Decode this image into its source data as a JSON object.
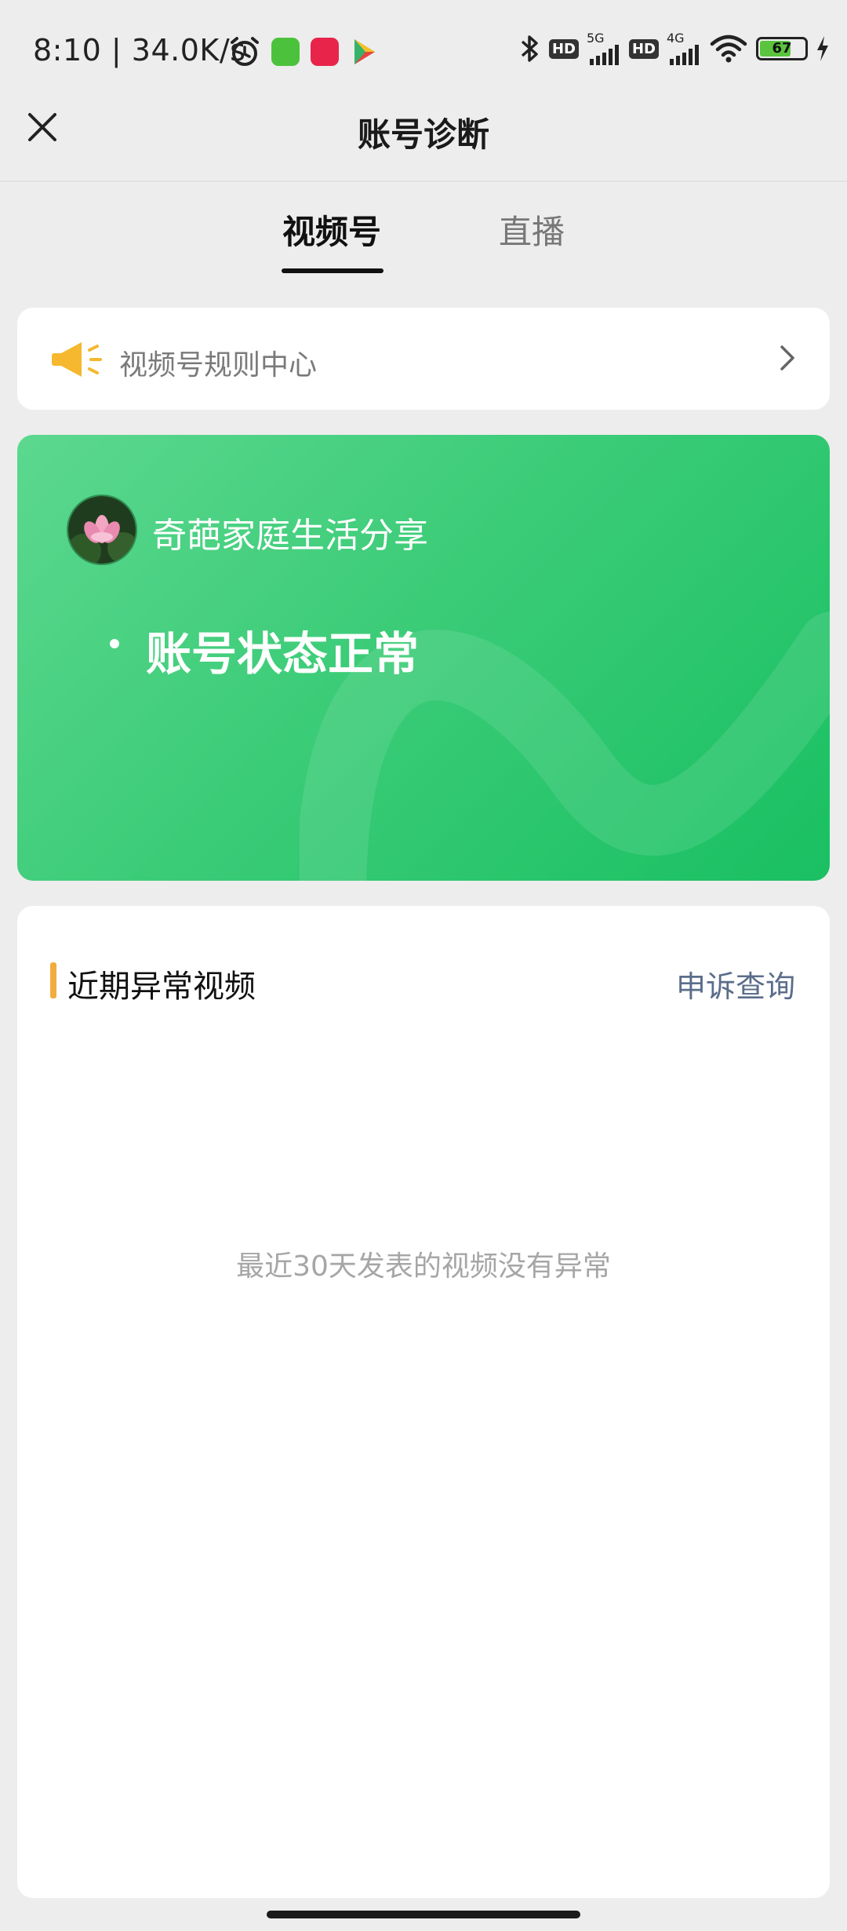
{
  "status_bar": {
    "time_speed": "8:10 | 34.0K/s",
    "hd1": "HD",
    "net1": "5G",
    "hd2": "HD",
    "net2": "4G",
    "battery": "67"
  },
  "header": {
    "title": "账号诊断"
  },
  "tabs": [
    {
      "label": "视频号",
      "active": true
    },
    {
      "label": "直播",
      "active": false
    }
  ],
  "rules_center": {
    "label": "视频号规则中心"
  },
  "account": {
    "name": "奇葩家庭生活分享",
    "status": "账号状态正常"
  },
  "recent": {
    "title": "近期异常视频",
    "appeal_link": "申诉查询",
    "empty_message": "最近30天发表的视频没有异常"
  },
  "colors": {
    "accent_green": "#3ccc78",
    "title_bar": "#f0ad3e",
    "link": "#5a6d8a"
  }
}
